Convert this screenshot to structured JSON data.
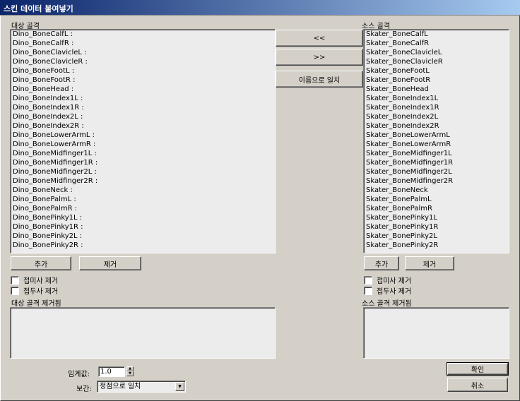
{
  "window": {
    "title": "스킨 데이터 붙여넣기"
  },
  "target": {
    "label": "대상 골격",
    "items": [
      "Dino_BoneCalfL :",
      "Dino_BoneCalfR :",
      "Dino_BoneClavicleL :",
      "Dino_BoneClavicleR :",
      "Dino_BoneFootL :",
      "Dino_BoneFootR :",
      "Dino_BoneHead :",
      "Dino_BoneIndex1L :",
      "Dino_BoneIndex1R :",
      "Dino_BoneIndex2L :",
      "Dino_BoneIndex2R :",
      "Dino_BoneLowerArmL :",
      "Dino_BoneLowerArmR :",
      "Dino_BoneMidfinger1L :",
      "Dino_BoneMidfinger1R :",
      "Dino_BoneMidfinger2L :",
      "Dino_BoneMidfinger2R :",
      "Dino_BoneNeck :",
      "Dino_BonePalmL :",
      "Dino_BonePalmR :",
      "Dino_BonePinky1L :",
      "Dino_BonePinky1R :",
      "Dino_BonePinky2L :",
      "Dino_BonePinky2R :"
    ],
    "add_label": "추가",
    "remove_label": "제거",
    "remove_prefix_label": "접미사 제거",
    "remove_suffix_label": "접두사 제거",
    "removed_label": "대상 골격 제거됨"
  },
  "source": {
    "label": "소스 골격",
    "items": [
      "Skater_BoneCalfL",
      "Skater_BoneCalfR",
      "Skater_BoneClavicleL",
      "Skater_BoneClavicleR",
      "Skater_BoneFootL",
      "Skater_BoneFootR",
      "Skater_BoneHead",
      "Skater_BoneIndex1L",
      "Skater_BoneIndex1R",
      "Skater_BoneIndex2L",
      "Skater_BoneIndex2R",
      "Skater_BoneLowerArmL",
      "Skater_BoneLowerArmR",
      "Skater_BoneMidfinger1L",
      "Skater_BoneMidfinger1R",
      "Skater_BoneMidfinger2L",
      "Skater_BoneMidfinger2R",
      "Skater_BoneNeck",
      "Skater_BonePalmL",
      "Skater_BonePalmR",
      "Skater_BonePinky1L",
      "Skater_BonePinky1R",
      "Skater_BonePinky2L",
      "Skater_BonePinky2R"
    ],
    "add_label": "추가",
    "remove_label": "제거",
    "remove_prefix_label": "접미사 제거",
    "remove_suffix_label": "접두사 제거",
    "removed_label": "소스 골격 제거됨"
  },
  "middle": {
    "left_button": "<<",
    "right_button": ">>",
    "match_by_name": "이름으로 일치"
  },
  "bottom": {
    "threshold_label": "임계값:",
    "threshold_value": "1.0",
    "interp_label": "보간:",
    "interp_value": "정점으로 일치"
  },
  "actions": {
    "ok": "확인",
    "cancel": "취소"
  },
  "colors": {
    "title_start": "#0a246a",
    "title_end": "#a6caf0",
    "face": "#d4d0c8",
    "list_bg": "#ececec"
  }
}
